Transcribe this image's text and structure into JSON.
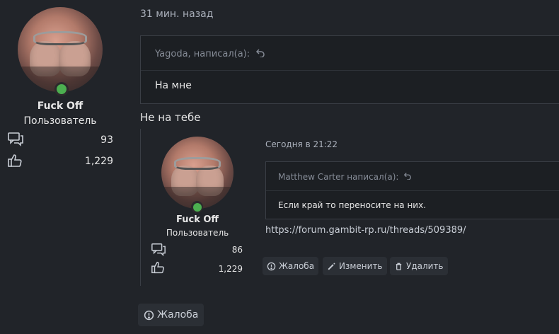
{
  "post": {
    "time": "31 мин. назад",
    "quote": {
      "author_line": "Yagoda, написал(а):",
      "text": "На мне"
    },
    "body": "Не на тебе",
    "report_label": "Жалоба"
  },
  "author": {
    "name": "Fuck Off",
    "role": "Пользователь",
    "messages": "93",
    "likes": "1,229"
  },
  "embedded": {
    "time": "Сегодня в 21:22",
    "quote": {
      "author_line": "Matthew Carter написал(а):",
      "text": "Если край то переносите на них."
    },
    "link": "https://forum.gambit-rp.ru/threads/509389/",
    "author": {
      "name": "Fuck Off",
      "role": "Пользователь",
      "messages": "86",
      "likes": "1,229"
    },
    "actions": {
      "report": "Жалоба",
      "edit": "Изменить",
      "delete": "Удалить"
    }
  },
  "colors": {
    "background": "#212429",
    "online": "#4caf50",
    "quote_bg": "#1c1f23"
  },
  "icons": [
    "messages-icon",
    "like-icon",
    "reply-arrow-icon",
    "report-icon",
    "edit-icon",
    "delete-icon"
  ]
}
